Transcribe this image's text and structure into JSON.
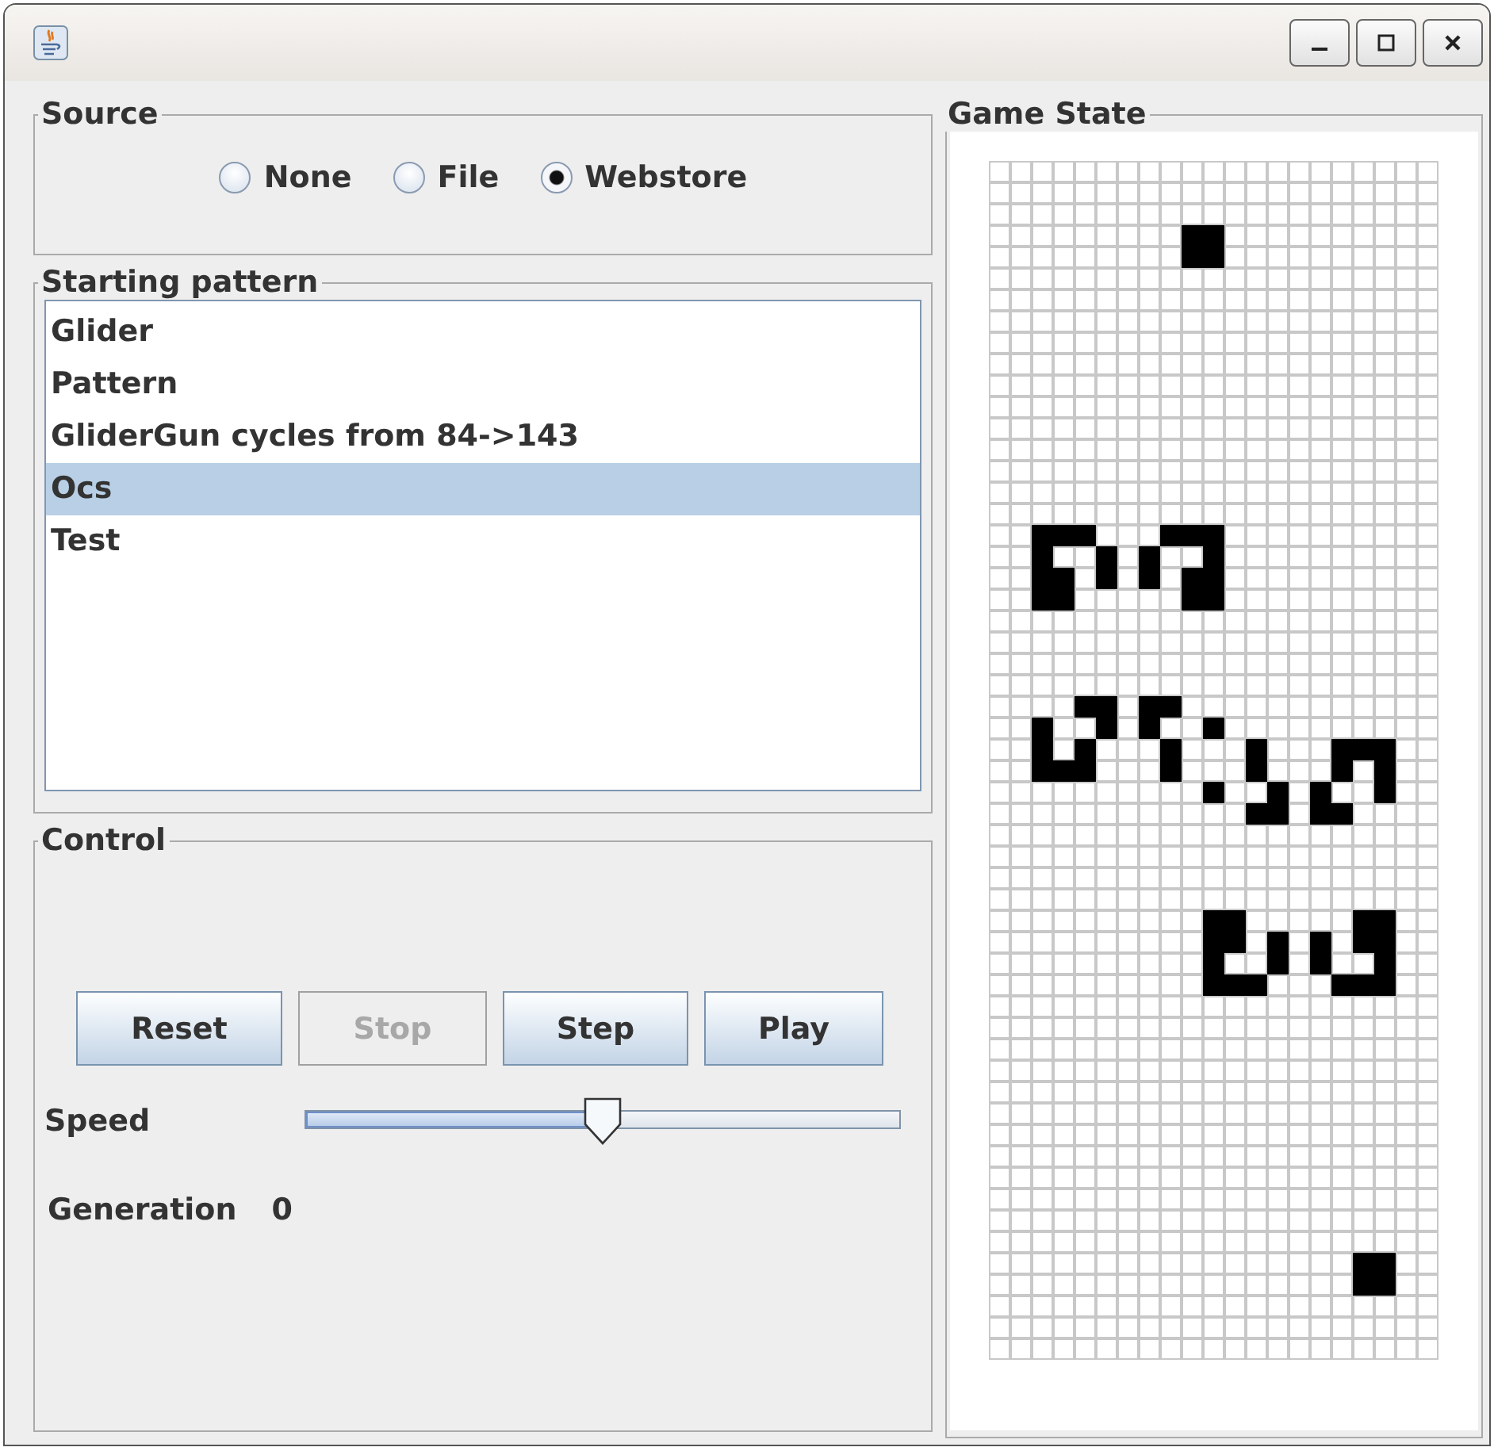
{
  "source": {
    "title": "Source",
    "options": [
      {
        "label": "None",
        "selected": false
      },
      {
        "label": "File",
        "selected": false
      },
      {
        "label": "Webstore",
        "selected": true
      }
    ]
  },
  "starting_pattern": {
    "title": "Starting pattern",
    "items": [
      {
        "label": "Glider",
        "selected": false
      },
      {
        "label": "Pattern",
        "selected": false
      },
      {
        "label": "GliderGun cycles from 84->143",
        "selected": false
      },
      {
        "label": "Ocs",
        "selected": true
      },
      {
        "label": "Test",
        "selected": false
      }
    ]
  },
  "control": {
    "title": "Control",
    "buttons": [
      {
        "label": "Reset",
        "disabled": false
      },
      {
        "label": "Stop",
        "disabled": true
      },
      {
        "label": "Step",
        "disabled": false
      },
      {
        "label": "Play",
        "disabled": false
      }
    ],
    "speed": {
      "label": "Speed",
      "level": 0.5
    },
    "generation": {
      "label": "Generation",
      "value": "0"
    }
  },
  "game_state": {
    "title": "Game State",
    "rows": [
      [
        false,
        false,
        false,
        false,
        false,
        false,
        false,
        false,
        false,
        false,
        false,
        false,
        false,
        false,
        false,
        false,
        false,
        false,
        false,
        false,
        false
      ],
      [
        false,
        false,
        false,
        false,
        false,
        false,
        false,
        false,
        false,
        false,
        false,
        false,
        false,
        false,
        false,
        false,
        false,
        false,
        false,
        false,
        false
      ],
      [
        false,
        false,
        false,
        false,
        false,
        false,
        false,
        false,
        false,
        false,
        false,
        false,
        false,
        false,
        false,
        false,
        false,
        false,
        false,
        false,
        false
      ],
      [
        false,
        false,
        false,
        false,
        false,
        false,
        false,
        false,
        false,
        true,
        true,
        false,
        false,
        false,
        false,
        false,
        false,
        false,
        false,
        false,
        false
      ],
      [
        false,
        false,
        false,
        false,
        false,
        false,
        false,
        false,
        false,
        true,
        true,
        false,
        false,
        false,
        false,
        false,
        false,
        false,
        false,
        false,
        false
      ],
      [
        false,
        false,
        false,
        false,
        false,
        false,
        false,
        false,
        false,
        false,
        false,
        false,
        false,
        false,
        false,
        false,
        false,
        false,
        false,
        false,
        false
      ],
      [
        false,
        false,
        false,
        false,
        false,
        false,
        false,
        false,
        false,
        false,
        false,
        false,
        false,
        false,
        false,
        false,
        false,
        false,
        false,
        false,
        false
      ],
      [
        false,
        false,
        false,
        false,
        false,
        false,
        false,
        false,
        false,
        false,
        false,
        false,
        false,
        false,
        false,
        false,
        false,
        false,
        false,
        false,
        false
      ],
      [
        false,
        false,
        false,
        false,
        false,
        false,
        false,
        false,
        false,
        false,
        false,
        false,
        false,
        false,
        false,
        false,
        false,
        false,
        false,
        false,
        false
      ],
      [
        false,
        false,
        false,
        false,
        false,
        false,
        false,
        false,
        false,
        false,
        false,
        false,
        false,
        false,
        false,
        false,
        false,
        false,
        false,
        false,
        false
      ],
      [
        false,
        false,
        false,
        false,
        false,
        false,
        false,
        false,
        false,
        false,
        false,
        false,
        false,
        false,
        false,
        false,
        false,
        false,
        false,
        false,
        false
      ],
      [
        false,
        false,
        false,
        false,
        false,
        false,
        false,
        false,
        false,
        false,
        false,
        false,
        false,
        false,
        false,
        false,
        false,
        false,
        false,
        false,
        false
      ],
      [
        false,
        false,
        false,
        false,
        false,
        false,
        false,
        false,
        false,
        false,
        false,
        false,
        false,
        false,
        false,
        false,
        false,
        false,
        false,
        false,
        false
      ],
      [
        false,
        false,
        false,
        false,
        false,
        false,
        false,
        false,
        false,
        false,
        false,
        false,
        false,
        false,
        false,
        false,
        false,
        false,
        false,
        false,
        false
      ],
      [
        false,
        false,
        false,
        false,
        false,
        false,
        false,
        false,
        false,
        false,
        false,
        false,
        false,
        false,
        false,
        false,
        false,
        false,
        false,
        false,
        false
      ],
      [
        false,
        false,
        false,
        false,
        false,
        false,
        false,
        false,
        false,
        false,
        false,
        false,
        false,
        false,
        false,
        false,
        false,
        false,
        false,
        false,
        false
      ],
      [
        false,
        false,
        false,
        false,
        false,
        false,
        false,
        false,
        false,
        false,
        false,
        false,
        false,
        false,
        false,
        false,
        false,
        false,
        false,
        false,
        false
      ],
      [
        false,
        false,
        true,
        true,
        true,
        false,
        false,
        false,
        true,
        true,
        true,
        false,
        false,
        false,
        false,
        false,
        false,
        false,
        false,
        false,
        false
      ],
      [
        false,
        false,
        true,
        false,
        false,
        true,
        false,
        true,
        false,
        false,
        true,
        false,
        false,
        false,
        false,
        false,
        false,
        false,
        false,
        false,
        false
      ],
      [
        false,
        false,
        true,
        true,
        false,
        true,
        false,
        true,
        false,
        true,
        true,
        false,
        false,
        false,
        false,
        false,
        false,
        false,
        false,
        false,
        false
      ],
      [
        false,
        false,
        true,
        true,
        false,
        false,
        false,
        false,
        false,
        true,
        true,
        false,
        false,
        false,
        false,
        false,
        false,
        false,
        false,
        false,
        false
      ],
      [
        false,
        false,
        false,
        false,
        false,
        false,
        false,
        false,
        false,
        false,
        false,
        false,
        false,
        false,
        false,
        false,
        false,
        false,
        false,
        false,
        false
      ],
      [
        false,
        false,
        false,
        false,
        false,
        false,
        false,
        false,
        false,
        false,
        false,
        false,
        false,
        false,
        false,
        false,
        false,
        false,
        false,
        false,
        false
      ],
      [
        false,
        false,
        false,
        false,
        false,
        false,
        false,
        false,
        false,
        false,
        false,
        false,
        false,
        false,
        false,
        false,
        false,
        false,
        false,
        false,
        false
      ],
      [
        false,
        false,
        false,
        false,
        false,
        false,
        false,
        false,
        false,
        false,
        false,
        false,
        false,
        false,
        false,
        false,
        false,
        false,
        false,
        false,
        false
      ],
      [
        false,
        false,
        false,
        false,
        true,
        true,
        false,
        true,
        true,
        false,
        false,
        false,
        false,
        false,
        false,
        false,
        false,
        false,
        false,
        false,
        false
      ],
      [
        false,
        false,
        true,
        false,
        false,
        true,
        false,
        true,
        false,
        false,
        true,
        false,
        false,
        false,
        false,
        false,
        false,
        false,
        false,
        false,
        false
      ],
      [
        false,
        false,
        true,
        false,
        true,
        false,
        false,
        false,
        true,
        false,
        false,
        false,
        true,
        false,
        false,
        false,
        true,
        true,
        true,
        false,
        false
      ],
      [
        false,
        false,
        true,
        true,
        true,
        false,
        false,
        false,
        true,
        false,
        false,
        false,
        true,
        false,
        false,
        false,
        true,
        false,
        true,
        false,
        false
      ],
      [
        false,
        false,
        false,
        false,
        false,
        false,
        false,
        false,
        false,
        false,
        true,
        false,
        false,
        true,
        false,
        true,
        false,
        false,
        true,
        false,
        false
      ],
      [
        false,
        false,
        false,
        false,
        false,
        false,
        false,
        false,
        false,
        false,
        false,
        false,
        true,
        true,
        false,
        true,
        true,
        false,
        false,
        false,
        false
      ],
      [
        false,
        false,
        false,
        false,
        false,
        false,
        false,
        false,
        false,
        false,
        false,
        false,
        false,
        false,
        false,
        false,
        false,
        false,
        false,
        false,
        false
      ],
      [
        false,
        false,
        false,
        false,
        false,
        false,
        false,
        false,
        false,
        false,
        false,
        false,
        false,
        false,
        false,
        false,
        false,
        false,
        false,
        false,
        false
      ],
      [
        false,
        false,
        false,
        false,
        false,
        false,
        false,
        false,
        false,
        false,
        false,
        false,
        false,
        false,
        false,
        false,
        false,
        false,
        false,
        false,
        false
      ],
      [
        false,
        false,
        false,
        false,
        false,
        false,
        false,
        false,
        false,
        false,
        false,
        false,
        false,
        false,
        false,
        false,
        false,
        false,
        false,
        false,
        false
      ],
      [
        false,
        false,
        false,
        false,
        false,
        false,
        false,
        false,
        false,
        false,
        true,
        true,
        false,
        false,
        false,
        false,
        false,
        true,
        true,
        false,
        false
      ],
      [
        false,
        false,
        false,
        false,
        false,
        false,
        false,
        false,
        false,
        false,
        true,
        true,
        false,
        true,
        false,
        true,
        false,
        true,
        true,
        false,
        false
      ],
      [
        false,
        false,
        false,
        false,
        false,
        false,
        false,
        false,
        false,
        false,
        true,
        false,
        false,
        true,
        false,
        true,
        false,
        false,
        true,
        false,
        false
      ],
      [
        false,
        false,
        false,
        false,
        false,
        false,
        false,
        false,
        false,
        false,
        true,
        true,
        true,
        false,
        false,
        false,
        true,
        true,
        true,
        false,
        false
      ],
      [
        false,
        false,
        false,
        false,
        false,
        false,
        false,
        false,
        false,
        false,
        false,
        false,
        false,
        false,
        false,
        false,
        false,
        false,
        false,
        false,
        false
      ],
      [
        false,
        false,
        false,
        false,
        false,
        false,
        false,
        false,
        false,
        false,
        false,
        false,
        false,
        false,
        false,
        false,
        false,
        false,
        false,
        false,
        false
      ],
      [
        false,
        false,
        false,
        false,
        false,
        false,
        false,
        false,
        false,
        false,
        false,
        false,
        false,
        false,
        false,
        false,
        false,
        false,
        false,
        false,
        false
      ],
      [
        false,
        false,
        false,
        false,
        false,
        false,
        false,
        false,
        false,
        false,
        false,
        false,
        false,
        false,
        false,
        false,
        false,
        false,
        false,
        false,
        false
      ],
      [
        false,
        false,
        false,
        false,
        false,
        false,
        false,
        false,
        false,
        false,
        false,
        false,
        false,
        false,
        false,
        false,
        false,
        false,
        false,
        false,
        false
      ],
      [
        false,
        false,
        false,
        false,
        false,
        false,
        false,
        false,
        false,
        false,
        false,
        false,
        false,
        false,
        false,
        false,
        false,
        false,
        false,
        false,
        false
      ],
      [
        false,
        false,
        false,
        false,
        false,
        false,
        false,
        false,
        false,
        false,
        false,
        false,
        false,
        false,
        false,
        false,
        false,
        false,
        false,
        false,
        false
      ],
      [
        false,
        false,
        false,
        false,
        false,
        false,
        false,
        false,
        false,
        false,
        false,
        false,
        false,
        false,
        false,
        false,
        false,
        false,
        false,
        false,
        false
      ],
      [
        false,
        false,
        false,
        false,
        false,
        false,
        false,
        false,
        false,
        false,
        false,
        false,
        false,
        false,
        false,
        false,
        false,
        false,
        false,
        false,
        false
      ],
      [
        false,
        false,
        false,
        false,
        false,
        false,
        false,
        false,
        false,
        false,
        false,
        false,
        false,
        false,
        false,
        false,
        false,
        false,
        false,
        false,
        false
      ],
      [
        false,
        false,
        false,
        false,
        false,
        false,
        false,
        false,
        false,
        false,
        false,
        false,
        false,
        false,
        false,
        false,
        false,
        false,
        false,
        false,
        false
      ],
      [
        false,
        false,
        false,
        false,
        false,
        false,
        false,
        false,
        false,
        false,
        false,
        false,
        false,
        false,
        false,
        false,
        false,
        false,
        false,
        false,
        false
      ],
      [
        false,
        false,
        false,
        false,
        false,
        false,
        false,
        false,
        false,
        false,
        false,
        false,
        false,
        false,
        false,
        false,
        false,
        true,
        true,
        false,
        false
      ],
      [
        false,
        false,
        false,
        false,
        false,
        false,
        false,
        false,
        false,
        false,
        false,
        false,
        false,
        false,
        false,
        false,
        false,
        true,
        true,
        false,
        false
      ],
      [
        false,
        false,
        false,
        false,
        false,
        false,
        false,
        false,
        false,
        false,
        false,
        false,
        false,
        false,
        false,
        false,
        false,
        false,
        false,
        false,
        false
      ],
      [
        false,
        false,
        false,
        false,
        false,
        false,
        false,
        false,
        false,
        false,
        false,
        false,
        false,
        false,
        false,
        false,
        false,
        false,
        false,
        false,
        false
      ],
      [
        false,
        false,
        false,
        false,
        false,
        false,
        false,
        false,
        false,
        false,
        false,
        false,
        false,
        false,
        false,
        false,
        false,
        false,
        false,
        false,
        false
      ]
    ]
  }
}
